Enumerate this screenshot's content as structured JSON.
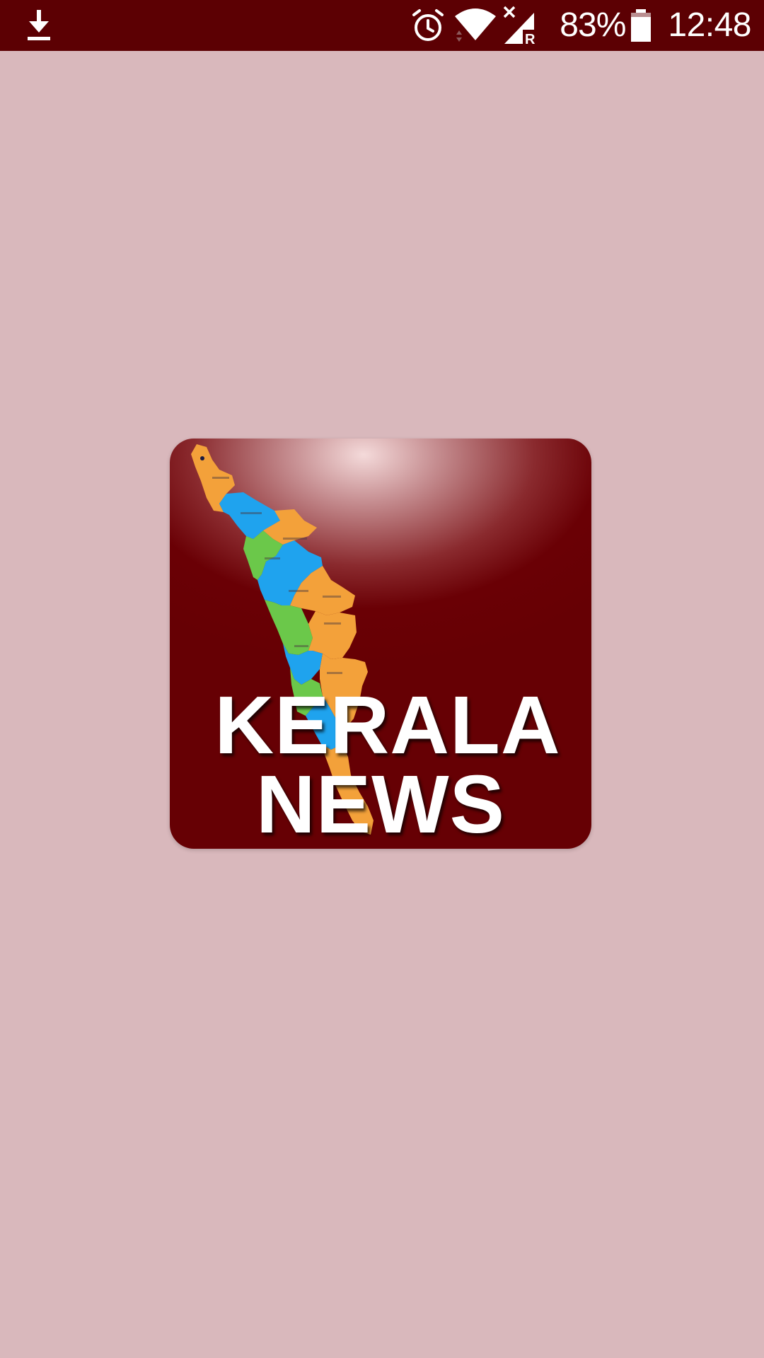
{
  "status_bar": {
    "left_icon": "download-icon",
    "icons": [
      "alarm-icon",
      "wifi-icon",
      "signal-roaming-icon",
      "battery-icon"
    ],
    "battery_percent": "83%",
    "time": "12:48"
  },
  "splash": {
    "logo_title_line1": "KERALA",
    "logo_title_line2": "NEWS"
  },
  "colors": {
    "status_bar": "#5c0003",
    "background": "#d9b8bc",
    "logo_dark_red": "#660004",
    "map_orange": "#f3a13a",
    "map_blue": "#1fa3ee",
    "map_green": "#6bc84a"
  }
}
